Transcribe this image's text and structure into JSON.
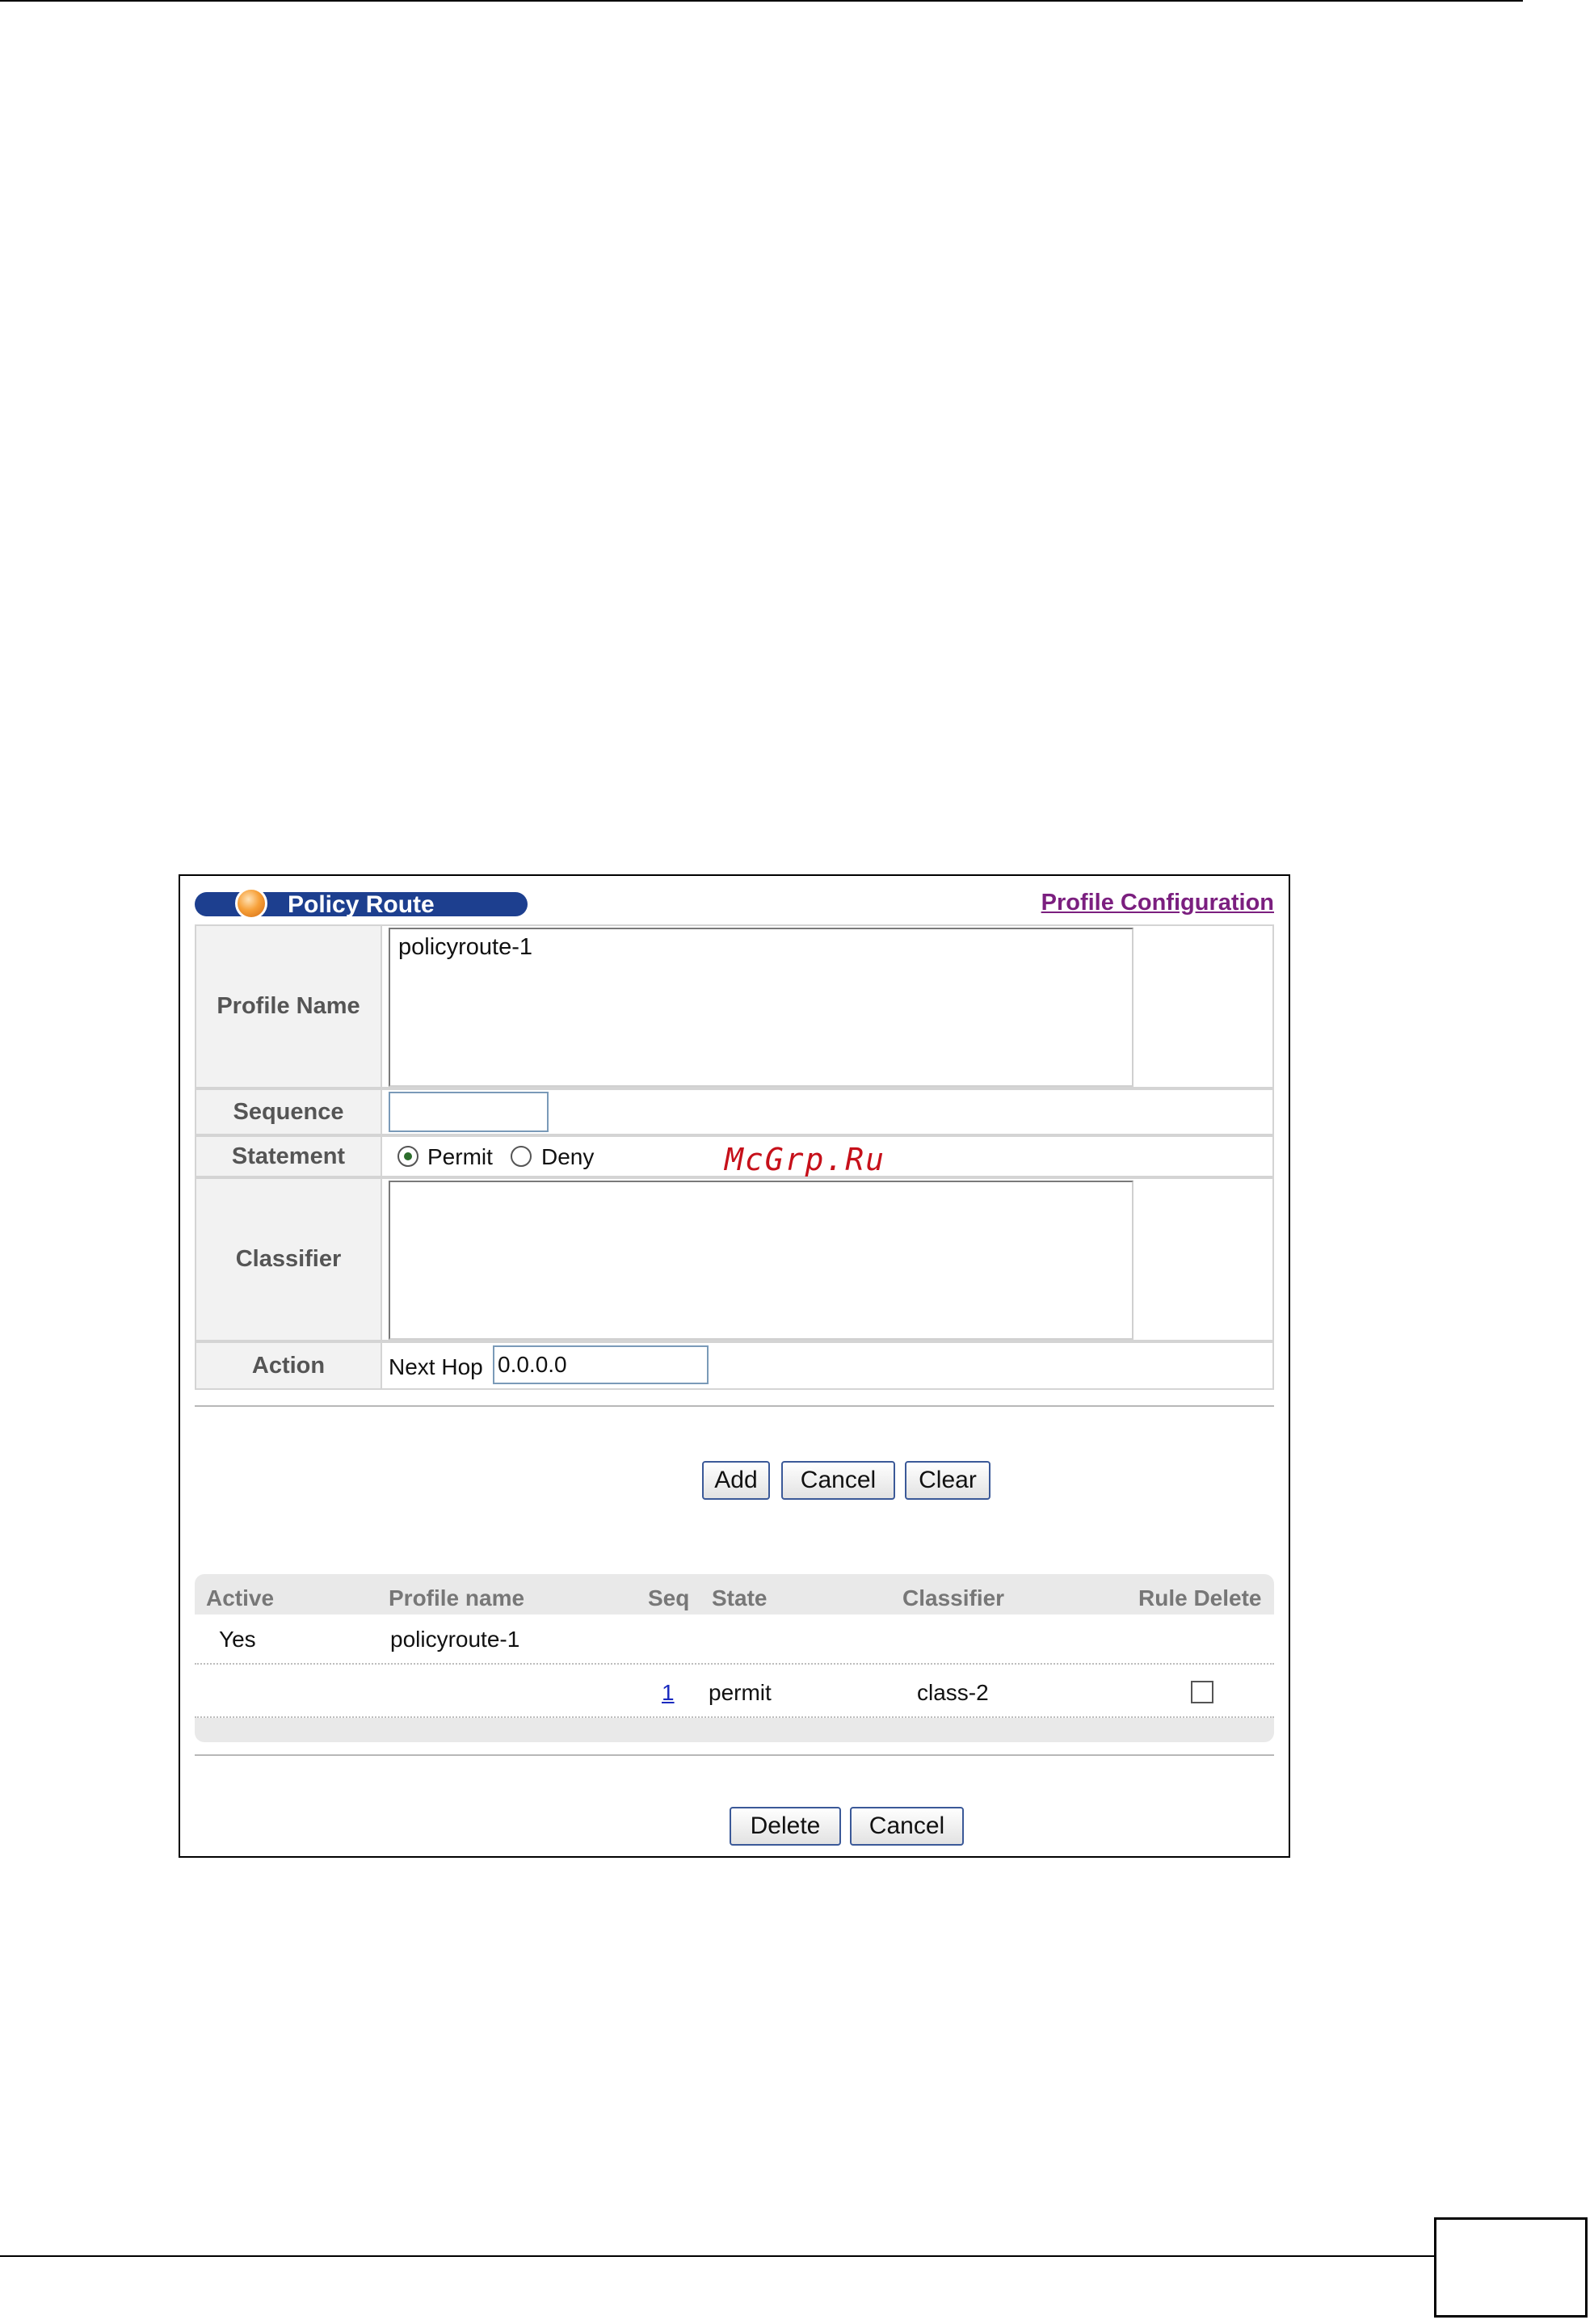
{
  "header": {
    "title": "Policy Route",
    "profile_link": "Profile Configuration"
  },
  "form": {
    "profile_name": {
      "label": "Profile Name",
      "value": "policyroute-1"
    },
    "sequence": {
      "label": "Sequence",
      "value": ""
    },
    "statement": {
      "label": "Statement",
      "options": [
        "Permit",
        "Deny"
      ],
      "selected": "Permit"
    },
    "classifier": {
      "label": "Classifier",
      "value": ""
    },
    "action": {
      "label": "Action",
      "next_hop_label": "Next Hop",
      "next_hop_value": "0.0.0.0"
    }
  },
  "form_buttons": {
    "add": "Add",
    "cancel": "Cancel",
    "clear": "Clear"
  },
  "list": {
    "headers": {
      "active": "Active",
      "profile_name": "Profile name",
      "seq": "Seq",
      "state": "State",
      "classifier": "Classifier",
      "rule_delete": "Rule Delete"
    },
    "profile_row": {
      "active": "Yes",
      "profile_name": "policyroute-1"
    },
    "rule_row": {
      "seq": "1",
      "state": "permit",
      "classifier": "class-2",
      "rule_delete_checked": false
    }
  },
  "list_buttons": {
    "delete": "Delete",
    "cancel": "Cancel"
  },
  "watermark": "McGrp.Ru",
  "colors": {
    "title_bar": "#1d3f8f",
    "link": "#7b1f7f",
    "watermark": "#c6101a",
    "button_border": "#3b5998"
  }
}
